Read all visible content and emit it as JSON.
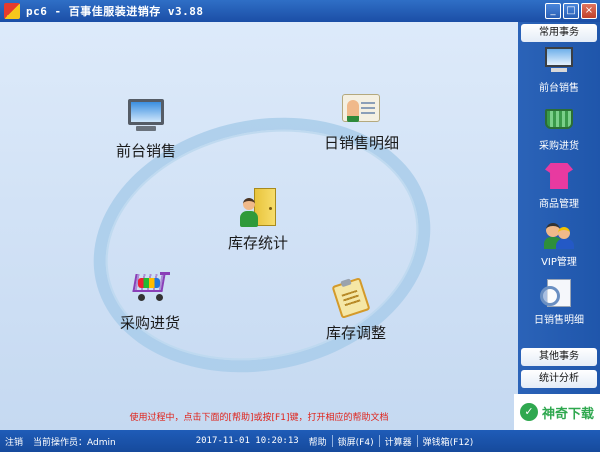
{
  "window": {
    "title": "pc6 - 百事佳服装进销存 v3.88",
    "controls": {
      "minimize": "_",
      "maximize": "□",
      "close": "×"
    }
  },
  "main": {
    "modules": [
      {
        "label": "前台销售",
        "icon": "monitor-icon"
      },
      {
        "label": "日销售明细",
        "icon": "id-card-icon"
      },
      {
        "label": "库存统计",
        "icon": "inventory-icon"
      },
      {
        "label": "采购进货",
        "icon": "shopping-cart-icon"
      },
      {
        "label": "库存调整",
        "icon": "clipboard-icon"
      }
    ],
    "hint": "使用过程中，点击下面的[帮助]或按[F1]键，打开相应的帮助文档"
  },
  "sidebar": {
    "header": "常用事务",
    "items": [
      {
        "label": "前台销售",
        "icon": "monitor-icon"
      },
      {
        "label": "采购进货",
        "icon": "basket-icon"
      },
      {
        "label": "商品管理",
        "icon": "tshirt-icon"
      },
      {
        "label": "VIP管理",
        "icon": "users-icon"
      },
      {
        "label": "日销售明细",
        "icon": "document-search-icon"
      }
    ],
    "other_tasks": "其他事务",
    "stats": "统计分析"
  },
  "watermark": {
    "text": "神奇下载"
  },
  "statusbar": {
    "logout": "注销",
    "operator": "当前操作员：Admin",
    "datetime": "2017-11-01 10:20:13",
    "help": "帮助",
    "lock": "锁屏(F4)",
    "calculator": "计算器",
    "cashbox": "弹钱箱(F12)"
  }
}
